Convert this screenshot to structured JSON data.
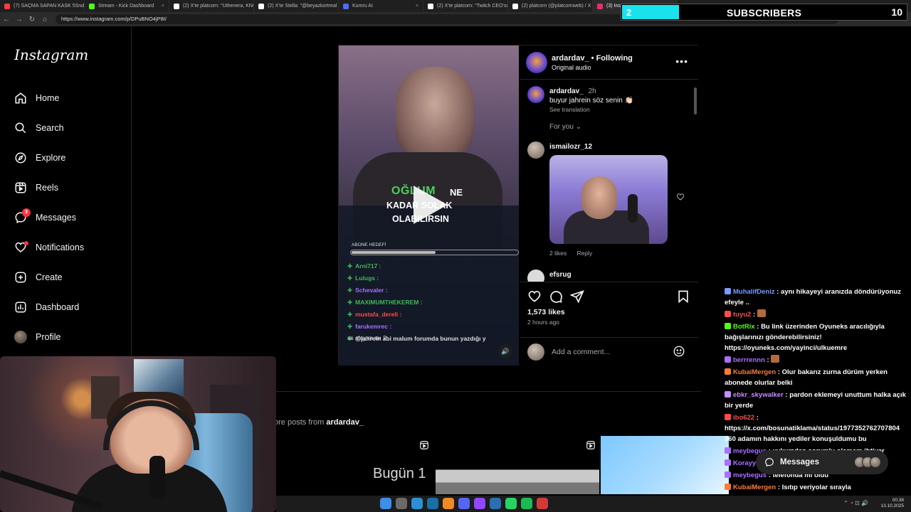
{
  "browser": {
    "tabs": [
      {
        "label": "(7) SAÇMA SAPAN KASK 5Snden",
        "color": "#ff3b3b"
      },
      {
        "label": "Stream - Kick Dashboard",
        "color": "#53fc18"
      },
      {
        "label": "(2) X'te platcorn: \"Uthenera, KNG",
        "color": "#ffffff"
      },
      {
        "label": "(2) X'te Stella: \"@beyazkortreal 8",
        "color": "#ffffff"
      },
      {
        "label": "Kumru AI",
        "color": "#4a6cf7"
      },
      {
        "label": "(2) X'te platcorn: \"Twitch CEO'su",
        "color": "#ffffff"
      },
      {
        "label": "(2) platcorn (@platcornweb) / X",
        "color": "#ffffff"
      },
      {
        "label": "(3) Instagram",
        "color": "#e1306c"
      }
    ],
    "url": "https://www.instagram.com/p/DPuBNO4jP8I/"
  },
  "subscribers": {
    "current": "2",
    "label": "SUBSCRIBERS",
    "goal": "10",
    "progress": 0.2
  },
  "sidebar": {
    "logo": "Instagram",
    "items": [
      {
        "label": "Home",
        "icon": "home-icon"
      },
      {
        "label": "Search",
        "icon": "search-icon"
      },
      {
        "label": "Explore",
        "icon": "explore-icon"
      },
      {
        "label": "Reels",
        "icon": "reels-icon"
      },
      {
        "label": "Messages",
        "icon": "messages-icon",
        "badge": "3"
      },
      {
        "label": "Notifications",
        "icon": "heart-icon"
      },
      {
        "label": "Create",
        "icon": "plus-icon"
      },
      {
        "label": "Dashboard",
        "icon": "dashboard-icon"
      },
      {
        "label": "Profile",
        "icon": "avatar"
      }
    ]
  },
  "post": {
    "username": "ardardav_",
    "follow_state": "Following",
    "audio": "Original audio",
    "caption_time": "2h",
    "caption": "buyur jahrein söz senin 👏🏻",
    "see_translation": "See translation",
    "for_you": "For you",
    "comment1_user": "ismailozr_12",
    "comment1_likes": "2 likes",
    "comment1_reply": "Reply",
    "comment2_user": "efsrug",
    "likes": "1,573 likes",
    "ago": "2 hours ago",
    "add_comment_placeholder": "Add a comment...",
    "video": {
      "caption_green": "OĞLUM",
      "caption_white": "NE",
      "caption_line2": "KADAR SOLAK",
      "caption_line3": "OLABILIRSIN",
      "goal_label": "ABONE HEDEFİ",
      "chat": [
        {
          "name": "Arni717 :",
          "color": "#3fb75a"
        },
        {
          "name": "Lulugs :",
          "color": "#3fb75a"
        },
        {
          "name": "Schevaler :",
          "color": "#a970ff"
        },
        {
          "name": "MAXIMUMTHEKEREM :",
          "color": "#3fb75a"
        },
        {
          "name": "mustafa_dereli :",
          "color": "#ff4b4b"
        },
        {
          "name": "farukemrec :",
          "color": "#a970ff"
        },
        {
          "name": "@jahrein abi malum forumda bunun yazdığı y",
          "color": "#dddddd"
        }
      ],
      "question": "ss alayım mı ?"
    }
  },
  "more_posts": {
    "prefix": "ore posts from",
    "username": "ardardav_",
    "thumb_text": "Bugün 1"
  },
  "messages_bar": {
    "label": "Messages"
  },
  "chat": [
    {
      "name": "MuhalifDeniz",
      "color": "#7a9cff",
      "text": " : aynı hikayeyi aranızda döndürüyonuz efeyle .."
    },
    {
      "name": "tuyu2",
      "color": "#ff4b4b",
      "text": " : "
    },
    {
      "name": "BotRix",
      "color": "#53fc18",
      "text": " : Bu link üzerinden Oyuneks aracılığıyla bağışlarınızı gönderebilirsiniz! https://oyuneks.com/yayinci/ulkuemre"
    },
    {
      "name": "berrrennn",
      "color": "#a970ff",
      "text": " : "
    },
    {
      "name": "KubaiMergen",
      "color": "#ff7b3a",
      "text": " : Olur bakarız zurna dürüm yerken abonede olurlar belki"
    },
    {
      "name": "ebkr_skywalker",
      "color": "#c98bff",
      "text": " : pardon eklemeyi unuttum halka açık bir yerde"
    },
    {
      "name": "ibo622",
      "color": "#ff4b4b",
      "text": " : https://x.com/bosunatiklama/status/1977352762707804 360 adamın hakkını yediler konuşuldumu bu"
    },
    {
      "name": "meybegus",
      "color": "#a970ff",
      "text": " : uykumdan sorumlu olamam ihtiyar"
    },
    {
      "name": "Korayyoss",
      "color": "#a970ff",
      "text": " : "
    },
    {
      "name": "meybegus",
      "color": "#a970ff",
      "text": " : telefonda mı oldu"
    },
    {
      "name": "KubaiMergen",
      "color": "#ff7b3a",
      "text": " : Isıtıp veriyolar sırayla"
    }
  ],
  "taskbar": {
    "time": "00:38",
    "date": "13.10.2025"
  }
}
